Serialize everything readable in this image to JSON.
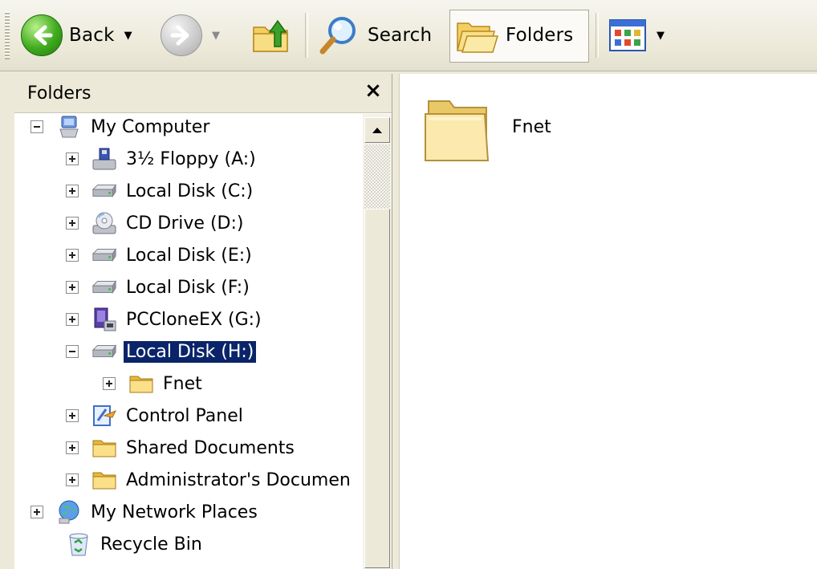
{
  "toolbar": {
    "back_label": "Back",
    "search_label": "Search",
    "folders_label": "Folders"
  },
  "folders_pane": {
    "title": "Folders",
    "close_symbol": "×"
  },
  "tree": [
    {
      "label": "My Computer",
      "expander": "minus",
      "icon": "computer-icon"
    },
    {
      "label": "3½ Floppy (A:)",
      "expander": "plus",
      "icon": "floppy-drive-icon"
    },
    {
      "label": "Local Disk (C:)",
      "expander": "plus",
      "icon": "hard-disk-icon"
    },
    {
      "label": "CD Drive (D:)",
      "expander": "plus",
      "icon": "cd-drive-icon"
    },
    {
      "label": "Local Disk (E:)",
      "expander": "plus",
      "icon": "hard-disk-icon"
    },
    {
      "label": "Local Disk (F:)",
      "expander": "plus",
      "icon": "hard-disk-icon"
    },
    {
      "label": "PCCloneEX (G:)",
      "expander": "plus",
      "icon": "pcclone-drive-icon"
    },
    {
      "label": "Local Disk (H:)",
      "expander": "minus",
      "icon": "hard-disk-icon",
      "selected": true
    },
    {
      "label": "Fnet",
      "expander": "plus",
      "icon": "folder-icon"
    },
    {
      "label": "Control Panel",
      "expander": "plus",
      "icon": "control-panel-icon"
    },
    {
      "label": "Shared Documents",
      "expander": "plus",
      "icon": "folder-icon"
    },
    {
      "label": "Administrator's Documen",
      "expander": "plus",
      "icon": "folder-icon"
    },
    {
      "label": "My Network Places",
      "expander": "plus",
      "icon": "network-places-icon"
    },
    {
      "label": "Recycle Bin",
      "expander": "none",
      "icon": "recycle-bin-icon"
    }
  ],
  "content": {
    "items": [
      {
        "label": "Fnet",
        "icon": "folder-icon"
      }
    ]
  },
  "colors": {
    "selection": "#0a246a",
    "chrome": "#ece9d8"
  }
}
